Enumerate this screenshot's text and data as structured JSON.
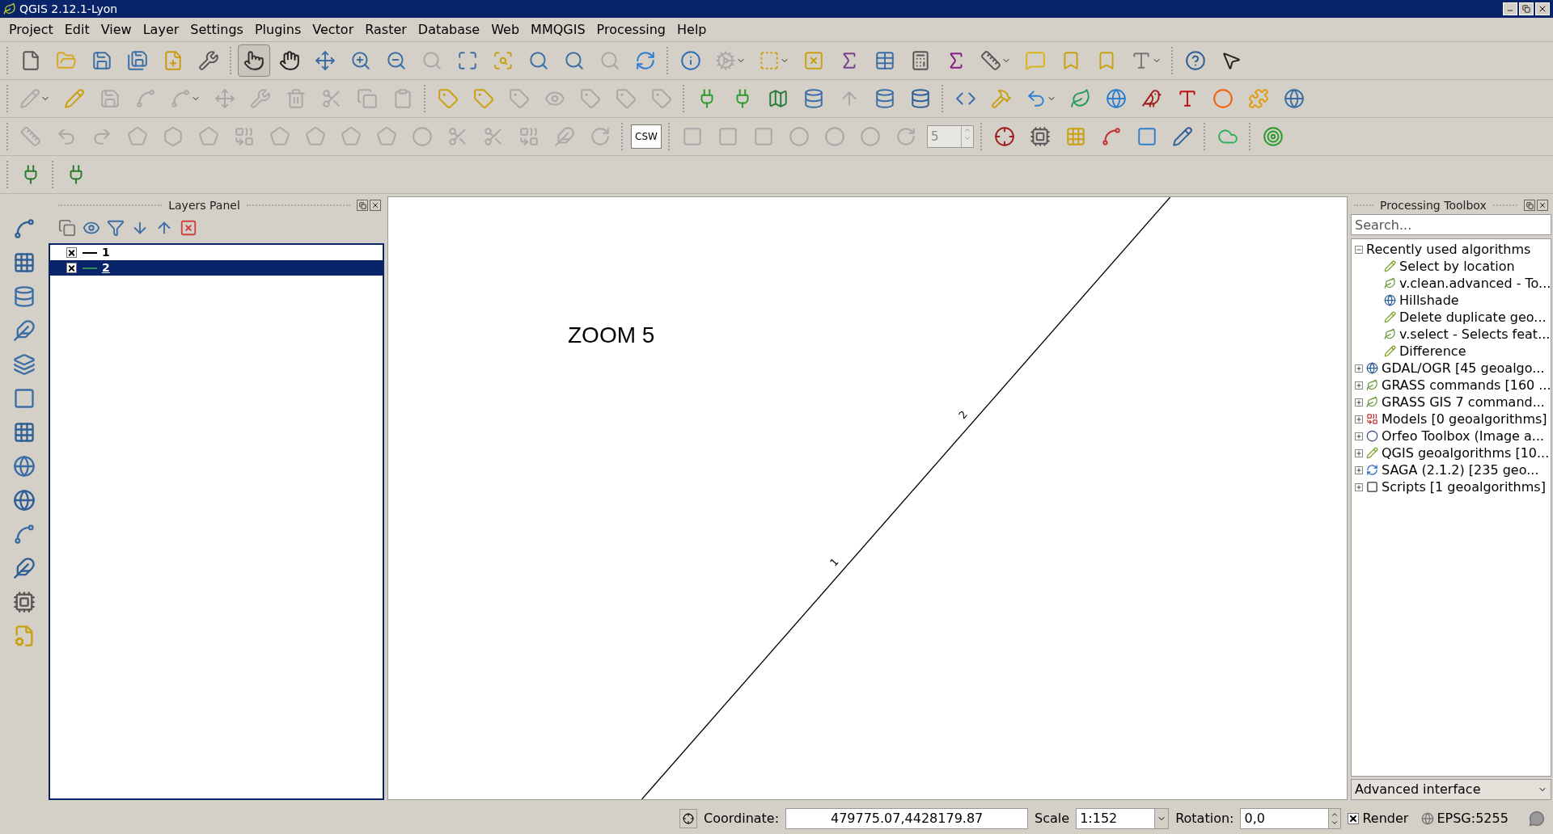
{
  "window": {
    "title": "QGIS 2.12.1-Lyon"
  },
  "menu": [
    "Project",
    "Edit",
    "View",
    "Layer",
    "Settings",
    "Plugins",
    "Vector",
    "Raster",
    "Database",
    "Web",
    "MMQGIS",
    "Processing",
    "Help"
  ],
  "toolbars": [
    {
      "buttons": [
        {
          "kind": "icon",
          "disabled": false,
          "selected": false
        },
        {
          "kind": "icon",
          "disabled": false,
          "selected": false
        },
        {
          "kind": "icon",
          "disabled": false,
          "selected": false
        },
        {
          "kind": "icon",
          "disabled": false,
          "selected": false
        },
        {
          "kind": "icon",
          "disabled": false,
          "selected": false
        },
        {
          "kind": "icon",
          "disabled": false,
          "selected": false
        },
        {
          "kind": "icon",
          "disabled": false,
          "selected": true
        },
        {
          "kind": "icon",
          "disabled": false,
          "selected": false
        },
        {
          "kind": "icon",
          "disabled": false,
          "selected": false
        },
        {
          "kind": "icon",
          "disabled": false,
          "selected": false
        },
        {
          "kind": "icon",
          "disabled": false,
          "selected": false
        },
        {
          "kind": "icon",
          "disabled": true,
          "selected": false
        },
        {
          "kind": "icon",
          "disabled": false,
          "selected": false
        },
        {
          "kind": "icon",
          "disabled": false,
          "selected": false
        },
        {
          "kind": "icon",
          "disabled": false,
          "selected": false
        },
        {
          "kind": "icon",
          "disabled": false,
          "selected": false
        },
        {
          "kind": "icon",
          "disabled": true,
          "selected": false
        },
        {
          "kind": "icon",
          "disabled": false,
          "selected": false
        },
        {
          "kind": "icon",
          "disabled": false,
          "selected": false
        },
        {
          "kind": "icon",
          "disabled": true,
          "selected": false
        },
        {
          "kind": "icon",
          "disabled": false,
          "selected": false
        },
        {
          "kind": "icon",
          "disabled": false,
          "selected": false
        },
        {
          "kind": "icon",
          "disabled": false,
          "selected": false
        },
        {
          "kind": "icon",
          "disabled": false,
          "selected": false
        },
        {
          "kind": "icon",
          "disabled": false,
          "selected": false
        },
        {
          "kind": "icon",
          "disabled": false,
          "selected": false
        },
        {
          "kind": "icon",
          "disabled": false,
          "selected": false
        },
        {
          "kind": "icon",
          "disabled": false,
          "selected": false
        },
        {
          "kind": "icon",
          "disabled": false,
          "selected": false
        },
        {
          "kind": "icon",
          "disabled": false,
          "selected": false
        },
        {
          "kind": "icon",
          "disabled": false,
          "selected": false
        },
        {
          "kind": "icon",
          "disabled": false,
          "selected": false
        },
        {
          "kind": "icon",
          "disabled": false,
          "selected": false
        }
      ]
    },
    {
      "buttons": [
        {
          "kind": "icon",
          "disabled": true
        },
        {
          "kind": "icon",
          "disabled": false
        },
        {
          "kind": "icon",
          "disabled": true
        },
        {
          "kind": "icon",
          "disabled": true
        },
        {
          "kind": "icon",
          "disabled": true
        },
        {
          "kind": "icon",
          "disabled": true
        },
        {
          "kind": "icon",
          "disabled": true
        },
        {
          "kind": "icon",
          "disabled": true
        },
        {
          "kind": "icon",
          "disabled": true
        },
        {
          "kind": "icon",
          "disabled": true
        },
        {
          "kind": "icon",
          "disabled": true
        },
        {
          "kind": "icon",
          "disabled": false
        },
        {
          "kind": "icon",
          "disabled": false
        },
        {
          "kind": "icon",
          "disabled": true
        },
        {
          "kind": "icon",
          "disabled": true
        },
        {
          "kind": "icon",
          "disabled": true
        },
        {
          "kind": "icon",
          "disabled": true
        },
        {
          "kind": "icon",
          "disabled": true
        },
        {
          "kind": "icon",
          "disabled": false
        },
        {
          "kind": "icon",
          "disabled": false
        },
        {
          "kind": "icon",
          "disabled": false
        },
        {
          "kind": "icon",
          "disabled": false
        },
        {
          "kind": "icon",
          "disabled": true
        },
        {
          "kind": "icon",
          "disabled": false
        },
        {
          "kind": "icon",
          "disabled": false
        },
        {
          "kind": "icon",
          "disabled": false
        },
        {
          "kind": "icon",
          "disabled": false
        },
        {
          "kind": "icon",
          "disabled": false
        },
        {
          "kind": "icon",
          "disabled": false
        },
        {
          "kind": "icon",
          "disabled": false
        },
        {
          "kind": "icon",
          "disabled": false
        },
        {
          "kind": "icon",
          "disabled": false
        },
        {
          "kind": "icon",
          "disabled": false
        },
        {
          "kind": "icon",
          "disabled": false
        },
        {
          "kind": "icon",
          "disabled": false
        }
      ]
    },
    {
      "buttons": [
        {
          "kind": "icon",
          "disabled": true
        },
        {
          "kind": "icon",
          "disabled": true
        },
        {
          "kind": "icon",
          "disabled": true
        },
        {
          "kind": "icon",
          "disabled": true
        },
        {
          "kind": "icon",
          "disabled": true
        },
        {
          "kind": "icon",
          "disabled": true
        },
        {
          "kind": "icon",
          "disabled": true
        },
        {
          "kind": "icon",
          "disabled": true
        },
        {
          "kind": "icon",
          "disabled": true
        },
        {
          "kind": "icon",
          "disabled": true
        },
        {
          "kind": "icon",
          "disabled": true
        },
        {
          "kind": "icon",
          "disabled": true
        },
        {
          "kind": "icon",
          "disabled": true
        },
        {
          "kind": "icon",
          "disabled": true
        },
        {
          "kind": "icon",
          "disabled": true
        },
        {
          "kind": "icon",
          "disabled": true
        },
        {
          "kind": "icon",
          "disabled": true
        },
        {
          "kind": "text",
          "label": "CSW",
          "disabled": false
        },
        {
          "kind": "icon",
          "disabled": true
        },
        {
          "kind": "icon",
          "disabled": true
        },
        {
          "kind": "icon",
          "disabled": true
        },
        {
          "kind": "icon",
          "disabled": true
        },
        {
          "kind": "icon",
          "disabled": true
        },
        {
          "kind": "icon",
          "disabled": true
        },
        {
          "kind": "icon",
          "disabled": true
        },
        {
          "kind": "spin",
          "value": "5",
          "disabled": true
        },
        {
          "kind": "icon",
          "disabled": false
        },
        {
          "kind": "icon",
          "disabled": false
        },
        {
          "kind": "icon",
          "disabled": false
        },
        {
          "kind": "icon",
          "disabled": false
        },
        {
          "kind": "icon",
          "disabled": false
        },
        {
          "kind": "icon",
          "disabled": false
        },
        {
          "kind": "icon",
          "disabled": false
        },
        {
          "kind": "icon",
          "disabled": false
        }
      ]
    },
    {
      "buttons": [
        {
          "kind": "icon",
          "disabled": false
        },
        {
          "kind": "icon",
          "disabled": false
        }
      ]
    }
  ],
  "layers_panel": {
    "title": "Layers Panel",
    "layers": [
      {
        "label": "1",
        "checked": true,
        "selected": false,
        "color": "#000000"
      },
      {
        "label": "2",
        "checked": true,
        "selected": true,
        "color": "#2e8b57"
      }
    ]
  },
  "map": {
    "title": "ZOOM 5",
    "features": [
      {
        "label": "1"
      },
      {
        "label": "2"
      }
    ]
  },
  "processing_toolbox": {
    "title": "Processing Toolbox",
    "search": {
      "placeholder": "Search..."
    },
    "tree": [
      {
        "label": "Recently used algorithms",
        "kind": "folder",
        "expanded": true,
        "children": [
          {
            "label": "Select by location",
            "kind": "qgis"
          },
          {
            "label": "v.clean.advanced - To...",
            "kind": "grass"
          },
          {
            "label": "Hillshade",
            "kind": "gdal"
          },
          {
            "label": "Delete duplicate geo...",
            "kind": "qgis"
          },
          {
            "label": "v.select - Selects feat...",
            "kind": "grass"
          },
          {
            "label": "Difference",
            "kind": "qgis"
          }
        ]
      },
      {
        "label": "GDAL/OGR [45 geoalgo...",
        "kind": "gdal",
        "expanded": false
      },
      {
        "label": "GRASS commands [160 ...",
        "kind": "grass",
        "expanded": false
      },
      {
        "label": "GRASS GIS 7 command...",
        "kind": "grass",
        "expanded": false
      },
      {
        "label": "Models [0 geoalgorithms]",
        "kind": "models",
        "expanded": false
      },
      {
        "label": "Orfeo Toolbox (Image a...",
        "kind": "orfeo",
        "expanded": false
      },
      {
        "label": "QGIS geoalgorithms [10...",
        "kind": "qgis",
        "expanded": false
      },
      {
        "label": "SAGA (2.1.2) [235 geo...",
        "kind": "saga",
        "expanded": false
      },
      {
        "label": "Scripts [1 geoalgorithms]",
        "kind": "scripts",
        "expanded": false
      }
    ],
    "interface": "Advanced interface"
  },
  "status_bar": {
    "coordinate_label": "Coordinate:",
    "coordinate": "479775.07,4428179.87",
    "scale_label": "Scale",
    "scale": "1:152",
    "rotation_label": "Rotation:",
    "rotation": "0,0",
    "render": {
      "label": "Render",
      "checked": true
    },
    "crs": "EPSG:5255"
  }
}
